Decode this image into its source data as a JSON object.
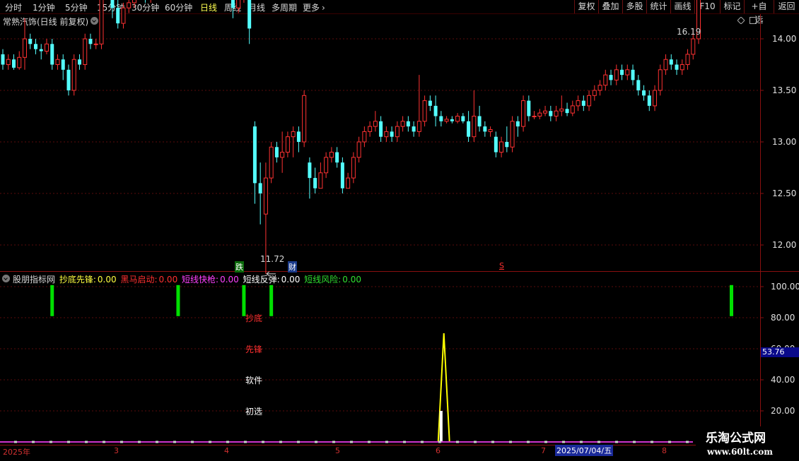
{
  "toolbar": {
    "periods": [
      "分时",
      "1分钟",
      "5分钟",
      "15分钟",
      "30分钟",
      "60分钟",
      "日线",
      "周线",
      "月线",
      "多周期",
      "更多"
    ],
    "active_period": "日线",
    "right_buttons": [
      "复权",
      "叠加",
      "多股",
      "统计",
      "画线",
      "F10",
      "标记",
      "+自选",
      "返回"
    ]
  },
  "stock": {
    "title": "常熟汽饰(日线 前复权)"
  },
  "price_panel": {
    "high_marker": "16.19",
    "low_marker": "11.72",
    "event_marks": {
      "die": "跌",
      "cai": "财",
      "s": "S"
    }
  },
  "indicator": {
    "name": "股朋指标网",
    "items": [
      {
        "label": "抄底先锋:",
        "value": "0.00",
        "color": "#ffff40"
      },
      {
        "label": "黑马启动:",
        "value": "0.00",
        "color": "#ff3030"
      },
      {
        "label": "短线快枪:",
        "value": "0.00",
        "color": "#ff40ff"
      },
      {
        "label": "短线反弹:",
        "value": "0.00",
        "color": "#ffffff"
      },
      {
        "label": "短线风险:",
        "value": "0.00",
        "color": "#30e030"
      }
    ],
    "signal_labels": {
      "chaodi": "抄底",
      "xianfeng": "先锋",
      "ruanjian": "软件",
      "chuxuan": "初选"
    },
    "current_value": "53.76"
  },
  "chart_data": [
    {
      "type": "candlestick",
      "title": "常熟汽饰(日线 前复权)",
      "y_ticks": [
        12.0,
        12.5,
        13.0,
        13.5,
        14.0,
        14.5,
        15.0,
        15.5,
        16.0
      ],
      "ylim": [
        11.5,
        16.5
      ],
      "x_tick_labels": [
        "2025年",
        "3",
        "4",
        "5",
        "6",
        "7",
        "2025/07/04/五",
        "8"
      ],
      "annotations": {
        "max": 16.19,
        "min": 11.72
      },
      "candles": [
        [
          13.85,
          13.75,
          13.9,
          13.7
        ],
        [
          13.75,
          13.8,
          13.85,
          13.7
        ],
        [
          13.8,
          13.72,
          13.85,
          13.7
        ],
        [
          13.72,
          13.82,
          13.88,
          13.7
        ],
        [
          13.82,
          14.0,
          14.2,
          13.7
        ],
        [
          14.0,
          13.95,
          14.05,
          13.9
        ],
        [
          13.95,
          13.9,
          14.0,
          13.85
        ],
        [
          13.9,
          13.88,
          13.95,
          13.8
        ],
        [
          13.88,
          13.95,
          14.0,
          13.85
        ],
        [
          13.95,
          13.75,
          14.0,
          13.7
        ],
        [
          13.75,
          13.8,
          13.85,
          13.7
        ],
        [
          13.8,
          13.7,
          13.85,
          13.6
        ],
        [
          13.7,
          13.5,
          13.75,
          13.45
        ],
        [
          13.5,
          13.8,
          13.85,
          13.45
        ],
        [
          13.8,
          13.75,
          13.85,
          13.7
        ],
        [
          13.75,
          14.0,
          14.05,
          13.7
        ],
        [
          14.0,
          13.95,
          14.05,
          13.9
        ],
        [
          13.95,
          13.95,
          14.0,
          13.9
        ],
        [
          13.95,
          14.55,
          14.6,
          13.9
        ],
        [
          14.55,
          14.45,
          14.65,
          14.4
        ],
        [
          14.45,
          14.3,
          14.6,
          14.2
        ],
        [
          14.3,
          14.15,
          14.4,
          14.1
        ],
        [
          14.15,
          14.3,
          14.35,
          14.1
        ],
        [
          14.3,
          14.35,
          14.4,
          14.25
        ],
        [
          14.35,
          14.5,
          14.6,
          14.3
        ],
        [
          14.5,
          14.6,
          14.65,
          14.45
        ],
        [
          14.6,
          14.4,
          14.65,
          14.35
        ],
        [
          14.4,
          14.45,
          14.5,
          14.35
        ],
        [
          14.45,
          15.0,
          15.45,
          14.4
        ],
        [
          15.0,
          14.85,
          15.1,
          14.7
        ],
        [
          14.85,
          14.7,
          14.95,
          14.6
        ],
        [
          14.7,
          15.0,
          15.05,
          14.65
        ],
        [
          15.0,
          15.35,
          15.4,
          14.95
        ],
        [
          15.35,
          15.3,
          15.45,
          15.25
        ],
        [
          15.3,
          15.35,
          15.4,
          15.2
        ],
        [
          15.35,
          15.0,
          15.4,
          14.9
        ],
        [
          15.0,
          14.75,
          15.05,
          14.7
        ],
        [
          14.75,
          14.8,
          14.85,
          14.6
        ],
        [
          14.8,
          14.7,
          14.9,
          14.65
        ],
        [
          14.7,
          14.5,
          14.75,
          14.45
        ],
        [
          14.5,
          14.65,
          14.7,
          14.45
        ],
        [
          14.65,
          14.5,
          14.7,
          14.4
        ],
        [
          14.5,
          14.3,
          14.6,
          14.2
        ],
        [
          14.3,
          14.4,
          14.45,
          14.25
        ],
        [
          14.4,
          14.55,
          14.6,
          14.35
        ],
        [
          14.55,
          14.1,
          14.6,
          13.95
        ],
        [
          13.15,
          12.6,
          13.2,
          12.4
        ],
        [
          12.6,
          12.5,
          12.8,
          12.2
        ],
        [
          12.3,
          12.65,
          12.8,
          11.72
        ],
        [
          12.65,
          12.95,
          13.0,
          12.6
        ],
        [
          12.95,
          12.85,
          13.0,
          12.8
        ],
        [
          12.85,
          12.9,
          13.1,
          12.7
        ],
        [
          12.9,
          13.05,
          13.1,
          12.85
        ],
        [
          13.05,
          13.1,
          13.15,
          12.85
        ],
        [
          13.1,
          13.0,
          13.15,
          12.9
        ],
        [
          13.0,
          13.45,
          13.5,
          12.95
        ],
        [
          12.8,
          12.65,
          12.85,
          12.45
        ],
        [
          12.65,
          12.55,
          12.75,
          12.5
        ],
        [
          12.55,
          12.7,
          12.8,
          12.55
        ],
        [
          12.7,
          12.85,
          12.9,
          12.65
        ],
        [
          12.85,
          12.9,
          12.95,
          12.8
        ],
        [
          12.9,
          12.8,
          12.95,
          12.75
        ],
        [
          12.8,
          12.55,
          12.85,
          12.5
        ],
        [
          12.55,
          12.65,
          12.7,
          12.55
        ],
        [
          12.65,
          12.85,
          12.9,
          12.6
        ],
        [
          12.85,
          13.0,
          13.05,
          12.8
        ],
        [
          13.0,
          13.1,
          13.15,
          12.95
        ],
        [
          13.1,
          13.15,
          13.2,
          13.05
        ],
        [
          13.15,
          13.2,
          13.3,
          13.1
        ],
        [
          13.2,
          13.05,
          13.25,
          13.0
        ],
        [
          13.05,
          13.1,
          13.15,
          13.0
        ],
        [
          13.1,
          13.05,
          13.15,
          13.0
        ],
        [
          13.05,
          13.15,
          13.2,
          13.0
        ],
        [
          13.15,
          13.2,
          13.25,
          13.1
        ],
        [
          13.2,
          13.15,
          13.25,
          13.1
        ],
        [
          13.15,
          13.1,
          13.2,
          13.05
        ],
        [
          13.1,
          13.2,
          13.65,
          13.05
        ],
        [
          13.2,
          13.4,
          13.45,
          13.15
        ],
        [
          13.4,
          13.35,
          13.45,
          13.3
        ],
        [
          13.35,
          13.25,
          13.45,
          13.15
        ],
        [
          13.25,
          13.2,
          13.3,
          13.15
        ],
        [
          13.2,
          13.22,
          13.25,
          13.18
        ],
        [
          13.22,
          13.2,
          13.25,
          13.18
        ],
        [
          13.2,
          13.25,
          13.28,
          13.18
        ],
        [
          13.25,
          13.2,
          13.28,
          13.18
        ],
        [
          13.2,
          13.05,
          13.3,
          13.0
        ],
        [
          13.05,
          13.25,
          13.5,
          13.0
        ],
        [
          13.25,
          13.15,
          13.35,
          13.1
        ],
        [
          13.15,
          13.1,
          13.2,
          13.05
        ],
        [
          13.1,
          13.12,
          13.15,
          13.05
        ],
        [
          13.05,
          12.9,
          13.1,
          12.85
        ],
        [
          12.9,
          13.0,
          13.05,
          12.85
        ],
        [
          13.0,
          12.95,
          13.15,
          12.9
        ],
        [
          12.95,
          13.2,
          13.25,
          12.9
        ],
        [
          13.2,
          13.15,
          13.25,
          13.05
        ],
        [
          13.15,
          13.4,
          13.45,
          13.1
        ],
        [
          13.4,
          13.25,
          13.45,
          13.2
        ],
        [
          13.25,
          13.25,
          13.3,
          13.22
        ],
        [
          13.25,
          13.28,
          13.32,
          13.22
        ],
        [
          13.28,
          13.3,
          13.35,
          13.25
        ],
        [
          13.3,
          13.25,
          13.35,
          13.2
        ],
        [
          13.25,
          13.3,
          13.35,
          13.2
        ],
        [
          13.3,
          13.32,
          13.45,
          13.25
        ],
        [
          13.32,
          13.28,
          13.38,
          13.25
        ],
        [
          13.28,
          13.35,
          13.4,
          13.25
        ],
        [
          13.35,
          13.4,
          13.45,
          13.3
        ],
        [
          13.4,
          13.35,
          13.45,
          13.3
        ],
        [
          13.35,
          13.45,
          13.5,
          13.3
        ],
        [
          13.45,
          13.5,
          13.55,
          13.4
        ],
        [
          13.5,
          13.55,
          13.6,
          13.45
        ],
        [
          13.55,
          13.65,
          13.7,
          13.5
        ],
        [
          13.65,
          13.6,
          13.7,
          13.55
        ],
        [
          13.6,
          13.7,
          13.75,
          13.55
        ],
        [
          13.7,
          13.65,
          13.75,
          13.6
        ],
        [
          13.65,
          13.7,
          13.75,
          13.6
        ],
        [
          13.7,
          13.6,
          13.75,
          13.55
        ],
        [
          13.6,
          13.5,
          13.65,
          13.45
        ],
        [
          13.5,
          13.45,
          13.55,
          13.4
        ],
        [
          13.45,
          13.35,
          13.5,
          13.3
        ],
        [
          13.35,
          13.5,
          13.55,
          13.3
        ],
        [
          13.5,
          13.7,
          13.75,
          13.45
        ],
        [
          13.7,
          13.8,
          13.85,
          13.65
        ],
        [
          13.8,
          13.75,
          13.85,
          13.7
        ],
        [
          13.75,
          13.7,
          13.8,
          13.65
        ],
        [
          13.7,
          13.75,
          13.8,
          13.65
        ],
        [
          13.75,
          13.85,
          13.9,
          13.7
        ],
        [
          13.85,
          14.0,
          14.1,
          13.8
        ],
        [
          14.0,
          14.95,
          15.0,
          13.95
        ],
        [
          14.95,
          15.05,
          15.2,
          14.8
        ],
        [
          15.05,
          14.85,
          16.19,
          14.8
        ],
        [
          14.85,
          15.5,
          15.55,
          14.8
        ],
        [
          15.5,
          14.9,
          15.55,
          14.85
        ],
        [
          14.9,
          15.1,
          15.2,
          14.85
        ],
        [
          15.1,
          14.95,
          15.15,
          14.85
        ],
        [
          14.95,
          14.75,
          15.05,
          14.7
        ],
        [
          14.75,
          14.85,
          14.9,
          14.6
        ]
      ]
    },
    {
      "type": "bar",
      "title": "股朋指标网",
      "y_ticks": [
        20.0,
        40.0,
        60.0,
        80.0,
        100.0
      ],
      "ylim": [
        0,
        110
      ],
      "series": [
        {
          "name": "短线风险",
          "color": "#00e000",
          "positions": [
            9,
            32,
            44,
            49,
            133,
            191,
            207,
            221
          ]
        },
        {
          "name": "黑马启动",
          "color": "#ff1010",
          "positions": [
            231,
            235
          ]
        },
        {
          "name": "抄底先锋",
          "color": "#ffff00",
          "peak_index": 80.5,
          "peak_value": 70
        },
        {
          "name": "短线反弹",
          "color": "#ffffff",
          "peak_index": 80,
          "peak_value": 20
        }
      ],
      "current_value": 53.76
    }
  ]
}
